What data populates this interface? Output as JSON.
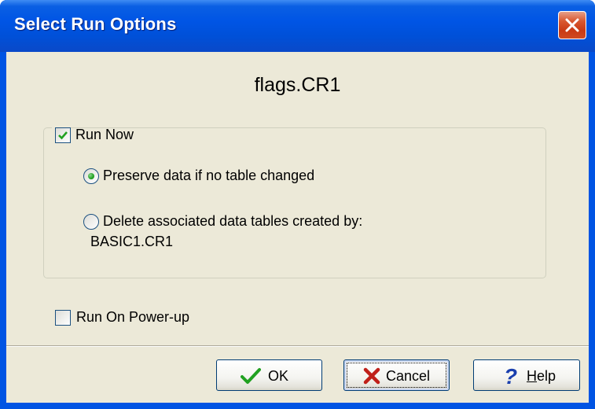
{
  "window": {
    "title": "Select Run Options"
  },
  "program": {
    "filename": "flags.CR1"
  },
  "run_now": {
    "label": "Run Now",
    "checked": true,
    "options": [
      {
        "label": "Preserve data if no table changed",
        "selected": true
      },
      {
        "label": "Delete associated data tables created by:",
        "sublabel": "BASIC1.CR1",
        "selected": false
      }
    ]
  },
  "run_on_powerup": {
    "label": "Run On Power-up",
    "checked": false
  },
  "buttons": {
    "ok": "OK",
    "cancel": "Cancel",
    "help_prefix": "H",
    "help_rest": "elp"
  },
  "icons": {
    "close": "close-icon",
    "ok": "check-icon",
    "cancel": "x-icon",
    "help": "question-icon"
  },
  "colors": {
    "titlebar": "#0055e5",
    "dialog_face": "#ece9d8",
    "close_button": "#d9572f",
    "check_green": "#21a121",
    "cancel_red": "#c0201a",
    "help_blue": "#1a3fae"
  }
}
